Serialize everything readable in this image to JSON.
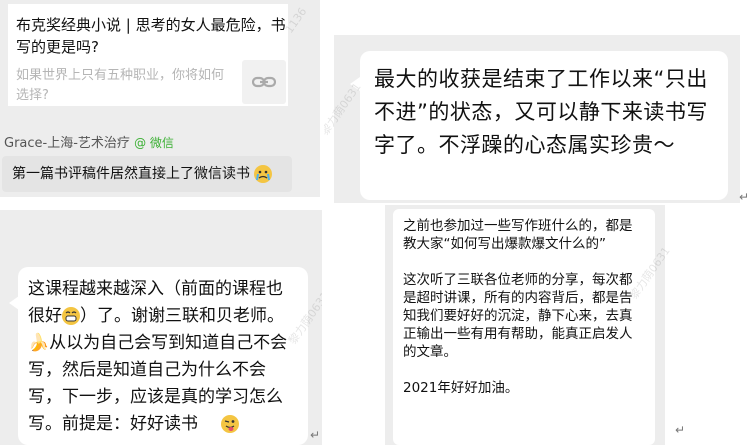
{
  "panel1": {
    "card_title": "布克奖经典小说 | 思考的女人最危险，书写的更是吗?",
    "card_subtitle": "如果世界上只有五种职业，你将如何选择?",
    "link_icon": "link-icon",
    "author": "Grace-上海-艺术治疗",
    "author_source": "@ 微信",
    "message": "第一篇书评稿件居然直接上了微信读书",
    "message_emoji": "crying-face-icon"
  },
  "panel2": {
    "text": "最大的收获是结束了工作以来“只出不进”的状态，又可以静下来读书写字了。不浮躁的心态属实珍贵～"
  },
  "panel3": {
    "text_1": "这课程越来越深入（前面的课程也很好",
    "text_2": "）了。谢谢三联和贝老师。",
    "text_3": "从以为自己会写到知道自己不会写，然后是知道自己为什么不会写，下一步，应该是真的学习怎么写。前提是：好好读书",
    "banana": "🍌",
    "emoji_grin": "grinning-face-icon",
    "emoji_tongue": "winking-tongue-face-icon"
  },
  "panel4": {
    "para_1": "之前也参加过一些写作班什么的，都是教大家“如何写出爆款爆文什么的”",
    "para_2": "这次听了三联各位老师的分享，每次都是超时讲课，所有的内容背后，都是告知我们要好好的沉淀，静下心来，去真正输出一些有用有帮助，能真正启发人的文章。",
    "para_3": "2021年好好加油。"
  },
  "watermarks": [
    "1136",
    "黎力荫0631",
    "黎力荫0631",
    "黎力荫0631"
  ],
  "return_mark": "↵"
}
